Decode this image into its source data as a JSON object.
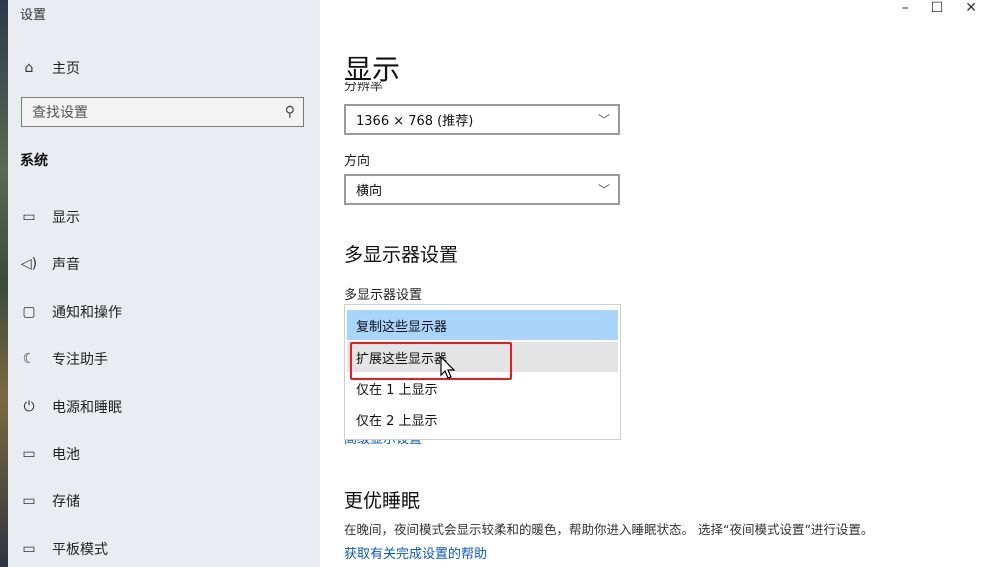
{
  "window": {
    "title": "设置",
    "controls": {
      "minimize": "–",
      "maximize": "☐",
      "close": "✕"
    }
  },
  "sidebar": {
    "home": {
      "label": "主页",
      "icon": "home-icon"
    },
    "search": {
      "placeholder": "查找设置",
      "icon": "search-icon"
    },
    "section": "系统",
    "items": [
      {
        "label": "显示",
        "icon": "monitor-icon",
        "glyph": "▭"
      },
      {
        "label": "声音",
        "icon": "speaker-icon",
        "glyph": "🔈"
      },
      {
        "label": "通知和操作",
        "icon": "notification-icon",
        "glyph": "▢"
      },
      {
        "label": "专注助手",
        "icon": "moon-icon",
        "glyph": "☾"
      },
      {
        "label": "电源和睡眠",
        "icon": "power-icon",
        "glyph": "⏻"
      },
      {
        "label": "电池",
        "icon": "battery-icon",
        "glyph": "▭"
      },
      {
        "label": "存储",
        "icon": "storage-icon",
        "glyph": "▭"
      },
      {
        "label": "平板模式",
        "icon": "tablet-icon",
        "glyph": "▭"
      }
    ]
  },
  "main": {
    "title": "显示",
    "resolution": {
      "label": "分辨率",
      "value": "1366 × 768 (推荐)"
    },
    "orientation": {
      "label": "方向",
      "value": "横向"
    },
    "multi_display": {
      "heading": "多显示器设置",
      "label": "多显示器设置",
      "options": [
        "复制这些显示器",
        "扩展这些显示器",
        "仅在 1 上显示",
        "仅在 2 上显示"
      ],
      "selected_index": 0,
      "hover_index": 1,
      "below_link": "高级显示设置"
    },
    "night": {
      "heading": "更优睡眠",
      "description": "在晚间，夜间模式会显示较柔和的暖色，帮助你进入睡眠状态。 选择“夜间模式设置”进行设置。",
      "help_link": "获取有关完成设置的帮助"
    }
  },
  "colors": {
    "selected_option": "#a9d4fb",
    "hover_option": "#e4e4e4",
    "annotation_box": "#e51c23",
    "link": "#0a5cc5"
  }
}
